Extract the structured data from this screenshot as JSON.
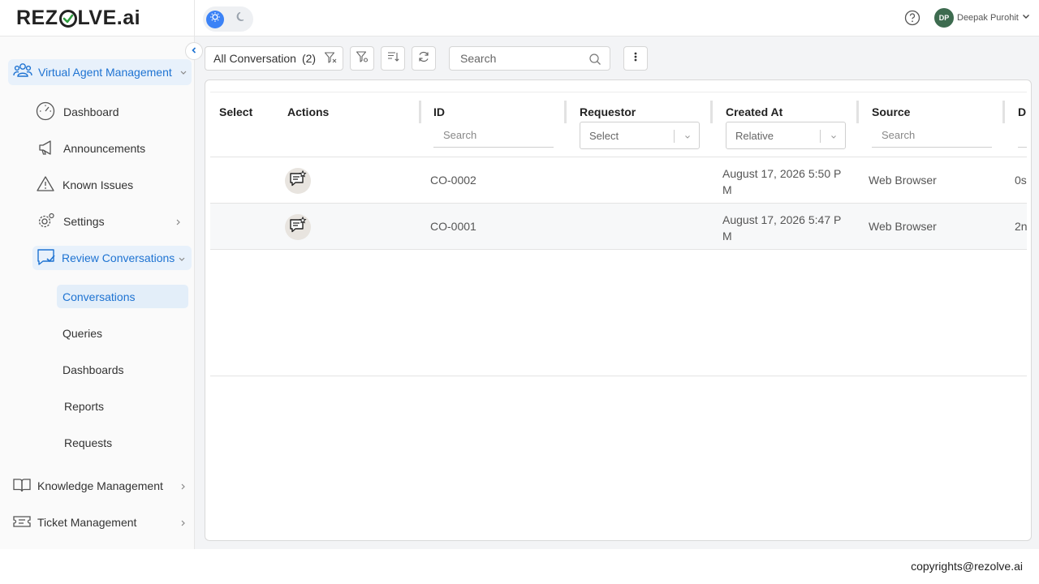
{
  "brand": {
    "logo_left": "REZ",
    "logo_right": "LVE.ai"
  },
  "header": {
    "user_initials": "DP",
    "user_name": "Deepak Purohit"
  },
  "sidebar": {
    "top_item": "Virtual Agent Management",
    "items": [
      {
        "label": "Dashboard"
      },
      {
        "label": "Announcements"
      },
      {
        "label": "Known Issues"
      },
      {
        "label": "Settings"
      },
      {
        "label": "Review Conversations"
      }
    ],
    "sub_items": [
      {
        "label": "Conversations"
      },
      {
        "label": "Queries"
      },
      {
        "label": "Dashboards"
      },
      {
        "label": "Reports"
      },
      {
        "label": "Requests"
      }
    ],
    "bottom_items": [
      {
        "label": "Knowledge Management"
      },
      {
        "label": "Ticket Management"
      }
    ]
  },
  "toolbar": {
    "filter_label": "All Conversation",
    "filter_count": "(2)",
    "search_placeholder": "Search"
  },
  "table": {
    "headers": {
      "select": "Select",
      "actions": "Actions",
      "id": "ID",
      "requestor": "Requestor",
      "created_at": "Created At",
      "source": "Source",
      "d": "D"
    },
    "filters": {
      "id_search": "Search",
      "requestor_select": "Select",
      "created_select": "Relative",
      "source_search": "Search"
    },
    "rows": [
      {
        "id": "CO-0002",
        "created_line1": "August 17, 2026 5:50 P",
        "created_line2": "M",
        "source": "Web Browser",
        "extra": "0s"
      },
      {
        "id": "CO-0001",
        "created_line1": "August 17, 2026 5:47 P",
        "created_line2": "M",
        "source": "Web Browser",
        "extra": "2n"
      }
    ]
  },
  "footer": {
    "text": "copyrights@rezolve.ai"
  },
  "colors": {
    "accent": "#1e73d2",
    "active_bg": "#e8f1fb",
    "avatar": "#3d6b4f"
  }
}
